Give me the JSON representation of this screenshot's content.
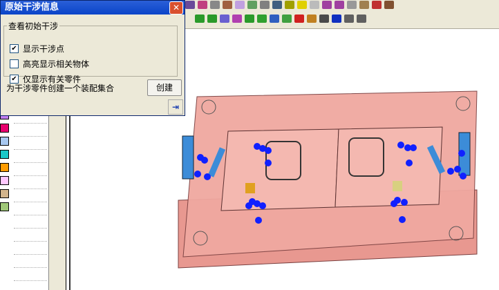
{
  "dialog": {
    "title": "原始干涉信息",
    "group_label": "查看初始干涉",
    "options": [
      {
        "label": "显示干涉点",
        "checked": true
      },
      {
        "label": "高亮显示相关物体",
        "checked": false
      },
      {
        "label": "仅显示有关零件",
        "checked": true
      }
    ],
    "create_text": "为干涉零件创建一个装配集合",
    "create_button": "创建"
  },
  "colors": {
    "swatches": [
      "#c07ef0",
      "#e8006e",
      "#a8c8f0",
      "#19c8c8",
      "#ff9c00",
      "#ffc8ff",
      "#d2b48c",
      "#a0c878"
    ],
    "mold": "#f0a8a0",
    "points": "#1020ff",
    "slider": "#3c8cd8"
  },
  "icons": {
    "toolbar_row1": [
      "cube",
      "cube-split",
      "edit",
      "camera",
      "box",
      "shade",
      "box-gray",
      "select",
      "bulb",
      "bulb-on",
      "bulb-off",
      "arrow-left",
      "arrow-right",
      "gears",
      "ruler",
      "mark",
      "tools"
    ],
    "toolbar_row2": [
      "add-comp",
      "add-comp-2",
      "add-table",
      "add-table-2",
      "add-star",
      "pattern",
      "mirror",
      "block",
      "delete",
      "mold",
      "replace",
      "next",
      "sketch",
      "curve"
    ]
  }
}
